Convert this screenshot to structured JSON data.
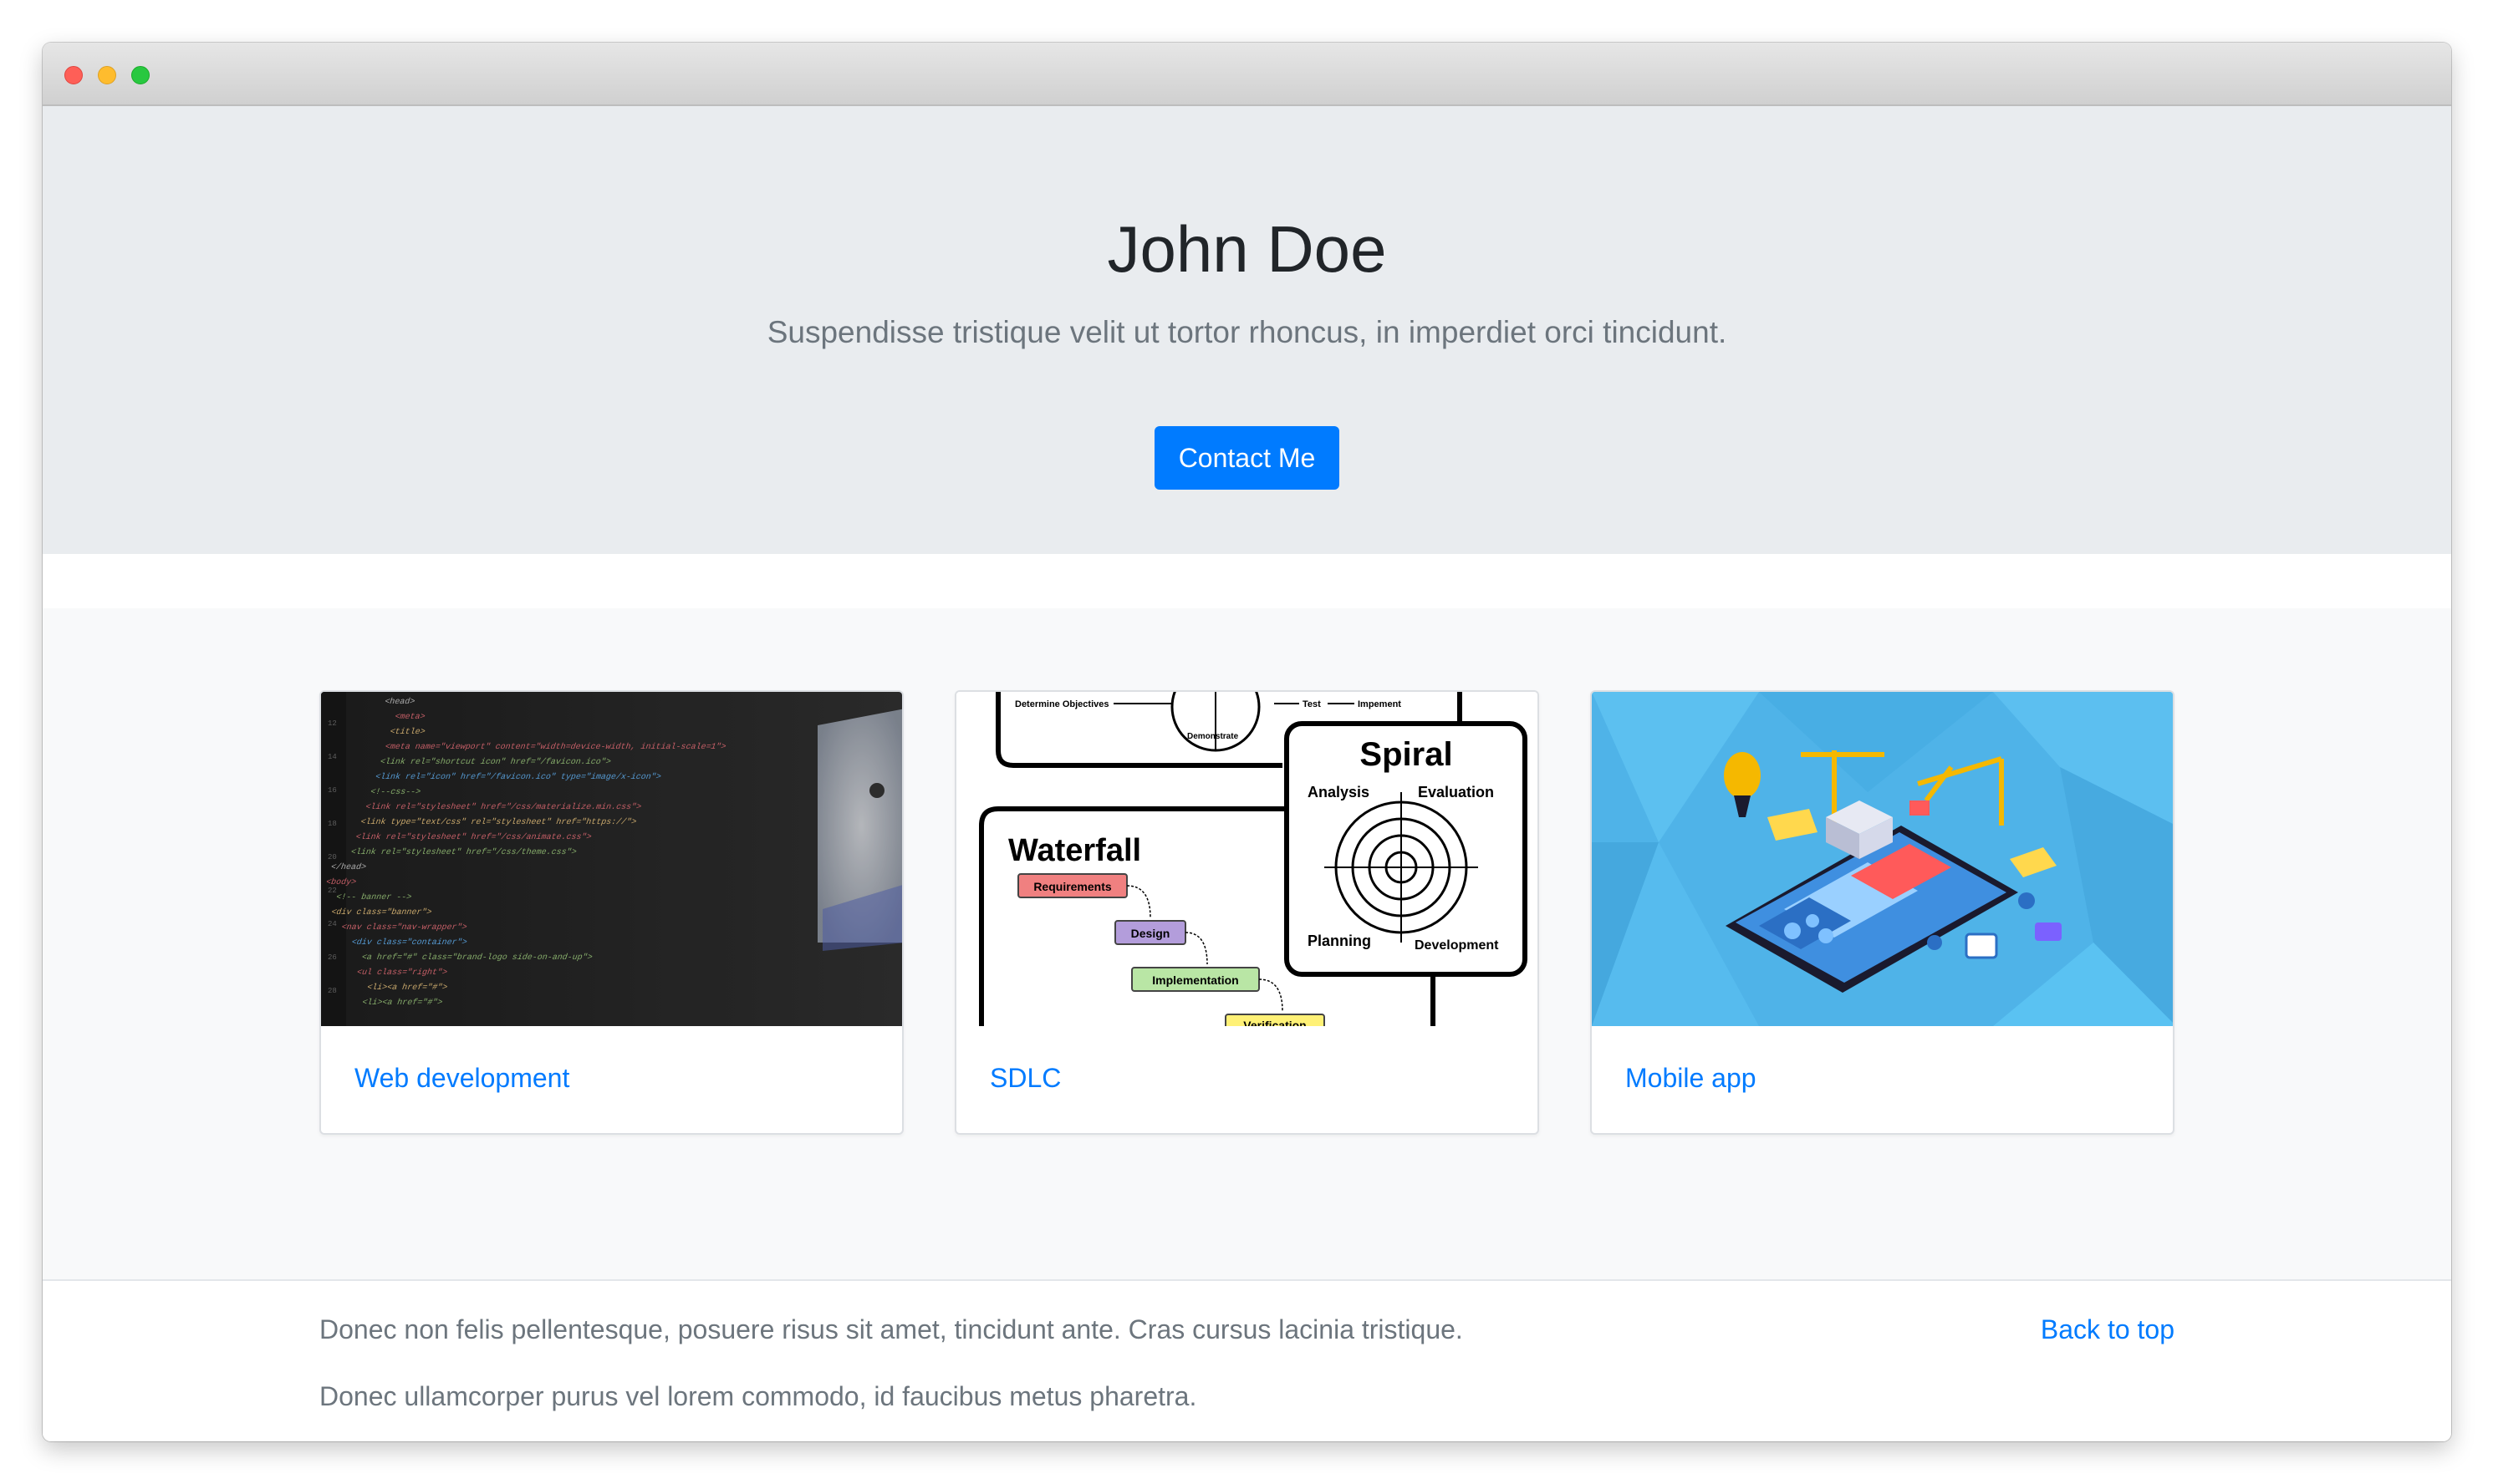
{
  "hero": {
    "title": "John Doe",
    "subtitle": "Suspendisse tristique velit ut tortor rhoncus, in imperdiet orci tincidunt.",
    "button_label": "Contact Me"
  },
  "cards": [
    {
      "label": "Web development",
      "image": "code-screen-photo"
    },
    {
      "label": "SDLC",
      "image": "sdlc-diagram"
    },
    {
      "label": "Mobile app",
      "image": "mobile-app-illustration"
    }
  ],
  "sdlc_diagram": {
    "spiral_title": "Spiral",
    "spiral_labels": [
      "Analysis",
      "Evaluation",
      "Planning",
      "Development"
    ],
    "top_labels": [
      "Determine Objectives",
      "Demonstrate",
      "Test",
      "Impement"
    ],
    "waterfall_title": "Waterfall",
    "waterfall_steps": [
      "Requirements",
      "Design",
      "Implementation",
      "Verification"
    ]
  },
  "footer": {
    "line1": "Donec non felis pellentesque, posuere risus sit amet, tincidunt ante. Cras cursus lacinia tristique.",
    "line2": "Donec ullamcorper purus vel lorem commodo, id faucibus metus pharetra.",
    "back_to_top": "Back to top"
  },
  "colors": {
    "accent": "#007bff",
    "hero_bg": "#e9ecef",
    "album_bg": "#f8f9fa",
    "text_muted": "#6c757d",
    "heading": "#212529"
  }
}
